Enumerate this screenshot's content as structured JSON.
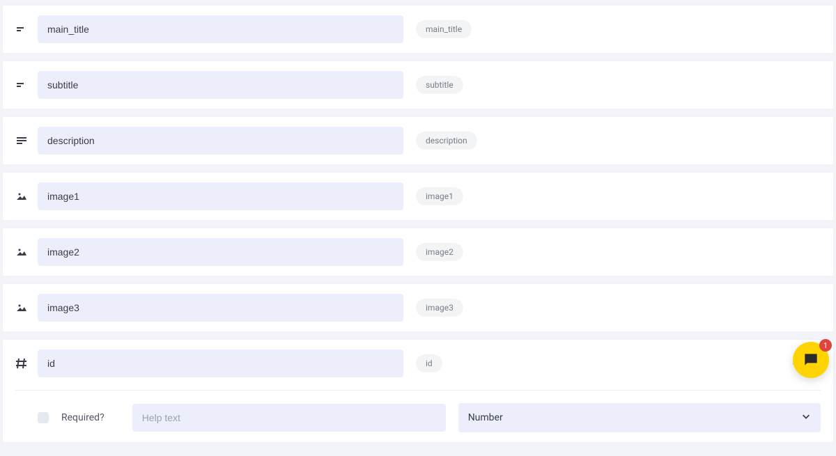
{
  "fields": [
    {
      "name": "main_title",
      "pill": "main_title",
      "icon": "short-text"
    },
    {
      "name": "subtitle",
      "pill": "subtitle",
      "icon": "short-text"
    },
    {
      "name": "description",
      "pill": "description",
      "icon": "long-text"
    },
    {
      "name": "image1",
      "pill": "image1",
      "icon": "image"
    },
    {
      "name": "image2",
      "pill": "image2",
      "icon": "image"
    },
    {
      "name": "image3",
      "pill": "image3",
      "icon": "image"
    }
  ],
  "active_field": {
    "name": "id",
    "pill": "id",
    "icon": "hash",
    "required_label": "Required?",
    "help_placeholder": "Help text",
    "type_selected": "Number"
  },
  "chat": {
    "badge": "1"
  }
}
